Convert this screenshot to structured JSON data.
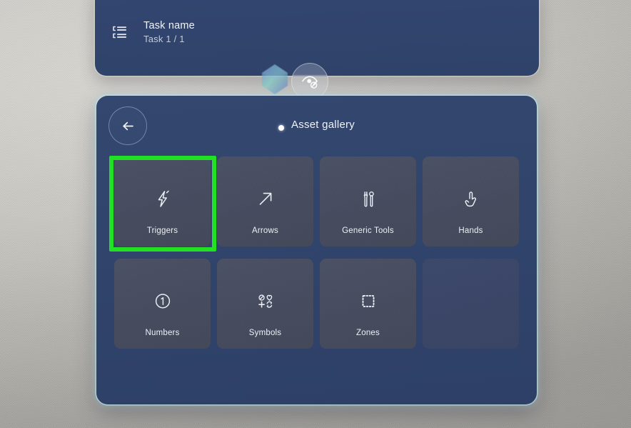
{
  "scene": {
    "environment": "mixed-reality-passthrough-wall",
    "wall_color": "#cbc9c3"
  },
  "task_panel": {
    "icon": "task-list-icon",
    "title": "Task name",
    "subtitle": "Task 1 / 1"
  },
  "floating_controls": {
    "gem": "holographic-gem-icon",
    "hide_button": {
      "icon": "eye-off-icon",
      "label": ""
    }
  },
  "gallery": {
    "back_button": {
      "icon": "arrow-left-icon",
      "label": ""
    },
    "title": "Asset gallery",
    "cursor": "gaze-cursor-dot",
    "tiles": [
      {
        "label": "Triggers",
        "icon": "lightning-bolt-icon",
        "selected": true
      },
      {
        "label": "Arrows",
        "icon": "arrow-up-right-icon",
        "selected": false
      },
      {
        "label": "Generic Tools",
        "icon": "tools-icon",
        "selected": false
      },
      {
        "label": "Hands",
        "icon": "pointing-hand-icon",
        "selected": false
      },
      {
        "label": "Numbers",
        "icon": "circled-one-icon",
        "selected": false
      },
      {
        "label": "Symbols",
        "icon": "symbols-grid-icon",
        "selected": false
      },
      {
        "label": "Zones",
        "icon": "dotted-square-icon",
        "selected": false
      },
      {
        "label": "",
        "icon": "",
        "selected": false
      }
    ]
  },
  "colors": {
    "panel_blue": "#31456f",
    "tile_gray": "#474d60",
    "selection_green": "#22e022",
    "text_primary": "#f0f3f8",
    "text_secondary": "#c3cbdb"
  }
}
